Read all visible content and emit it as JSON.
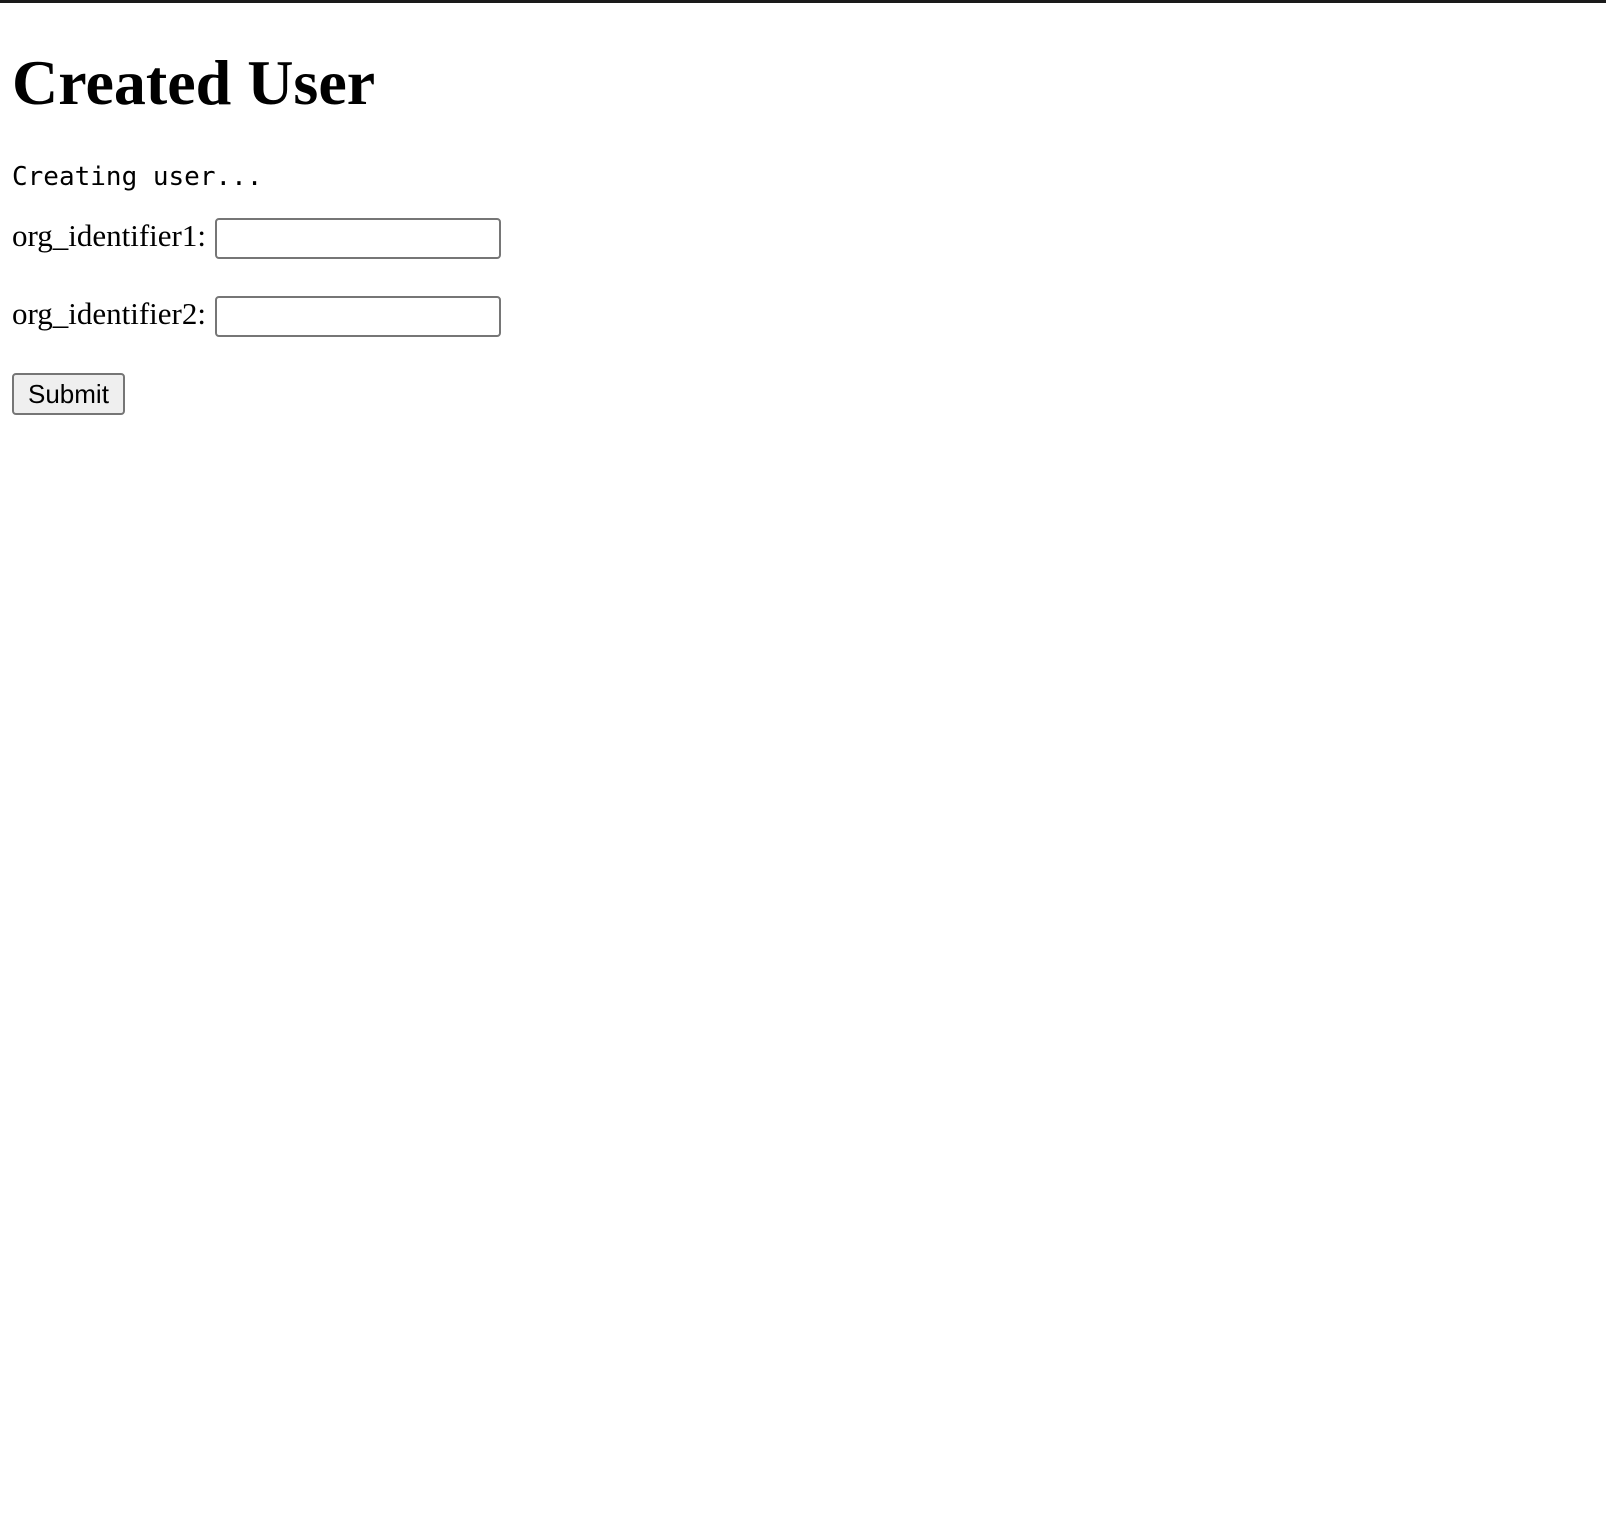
{
  "page": {
    "title": "Created User",
    "status": "Creating user..."
  },
  "form": {
    "fields": [
      {
        "label": "org_identifier1:",
        "value": "",
        "placeholder": ""
      },
      {
        "label": "org_identifier2:",
        "value": "",
        "placeholder": ""
      }
    ],
    "submit_label": "Submit"
  },
  "colors": {
    "background": "#ffffff",
    "text": "#000000",
    "input_border": "#767676",
    "button_background": "#efefef"
  }
}
